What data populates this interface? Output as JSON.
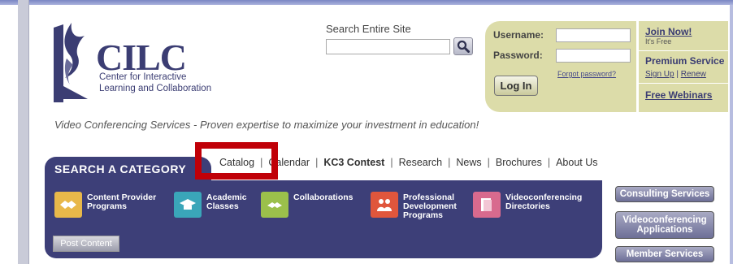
{
  "logo": {
    "title": "CILC",
    "subtitle_line1": "Center for Interactive",
    "subtitle_line2": "Learning and Collaboration"
  },
  "search": {
    "label": "Search Entire Site",
    "value": "",
    "placeholder": ""
  },
  "login": {
    "username_label": "Username:",
    "password_label": "Password:",
    "username_value": "",
    "password_value": "",
    "forgot_label": "Forgot password?",
    "login_button": "Log In"
  },
  "side": {
    "join": "Join Now!",
    "free": "It's Free",
    "premium": "Premium Service",
    "sign_up": "Sign Up",
    "pipe": "|",
    "renew": "Renew",
    "webinars": "Free Webinars"
  },
  "tagline": "Video Conferencing Services - Proven expertise to maximize your investment in education!",
  "search_category": "SEARCH A CATEGORY",
  "nav": {
    "sep": "|",
    "items": [
      "Catalog",
      "Calendar",
      "KC3 Contest",
      "Research",
      "News",
      "Brochures",
      "About Us"
    ]
  },
  "categories": [
    {
      "line1": "Content Provider",
      "line2": "Programs",
      "line3": "",
      "icon": "handshake-icon",
      "color": "#e8b84a"
    },
    {
      "line1": "Academic",
      "line2": "Classes",
      "line3": "",
      "icon": "graduation-cap-icon",
      "color": "#3aa6b9"
    },
    {
      "line1": "Collaborations",
      "line2": "",
      "line3": "",
      "icon": "collaboration-icon",
      "color": "#9bc04b"
    },
    {
      "line1": "Professional",
      "line2": "Development",
      "line3": "Programs",
      "icon": "people-icon",
      "color": "#e0563c"
    },
    {
      "line1": "Videoconferencing",
      "line2": "Directories",
      "line3": "",
      "icon": "directory-icon",
      "color": "#d86a8e"
    }
  ],
  "post_content": "Post Content",
  "services": {
    "consulting": "Consulting Services",
    "vc_apps_line1": "Videoconferencing",
    "vc_apps_line2": "Applications",
    "member": "Member Services"
  },
  "colors": {
    "brand_navy": "#3d3f78",
    "login_bg": "#dcdca9",
    "highlight": "#c00008"
  }
}
